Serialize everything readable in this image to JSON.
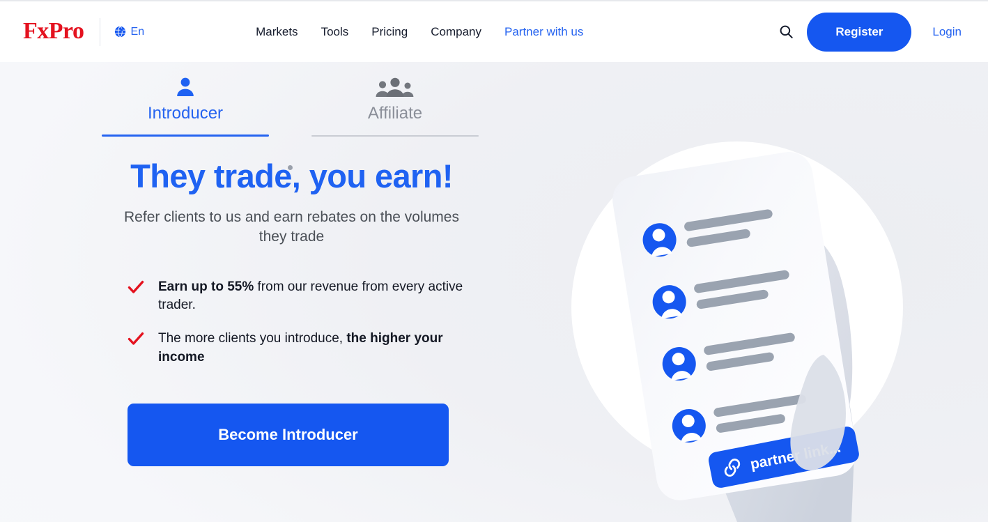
{
  "header": {
    "logo_text": "FxPro",
    "language": {
      "icon": "globe-icon",
      "label": "En"
    },
    "nav": [
      {
        "label": "Markets",
        "accent": false
      },
      {
        "label": "Tools",
        "accent": false
      },
      {
        "label": "Pricing",
        "accent": false
      },
      {
        "label": "Company",
        "accent": false
      },
      {
        "label": "Partner with us",
        "accent": true
      }
    ],
    "search_icon": "search-icon",
    "register_label": "Register",
    "login_label": "Login"
  },
  "hero": {
    "tabs": [
      {
        "label": "Introducer",
        "icon": "person-icon",
        "active": true
      },
      {
        "label": "Affiliate",
        "icon": "group-icon",
        "active": false
      }
    ],
    "headline": "They trade, you earn!",
    "subhead": "Refer clients to us and earn rebates on the volumes they trade",
    "benefits": [
      {
        "strong_lead": "Earn up to 55%",
        "rest": " from our revenue from every active trader.",
        "bold_tail": ""
      },
      {
        "strong_lead": "",
        "rest": "The more clients you introduce, ",
        "bold_tail": "the higher your income"
      }
    ],
    "cta_label": "Become Introducer",
    "illustration": {
      "name": "hand-holding-phone-illustration",
      "link_pill_label": "partner link...",
      "link_pill_icon": "chain-link-icon",
      "contact_rows": 4
    }
  },
  "colors": {
    "brand_red": "#e4121f",
    "accent_blue": "#1557f0",
    "link_blue": "#2563f0",
    "text_dark": "#141824",
    "muted_gray": "#8b8f99",
    "page_bg": "#f4f5f8"
  }
}
